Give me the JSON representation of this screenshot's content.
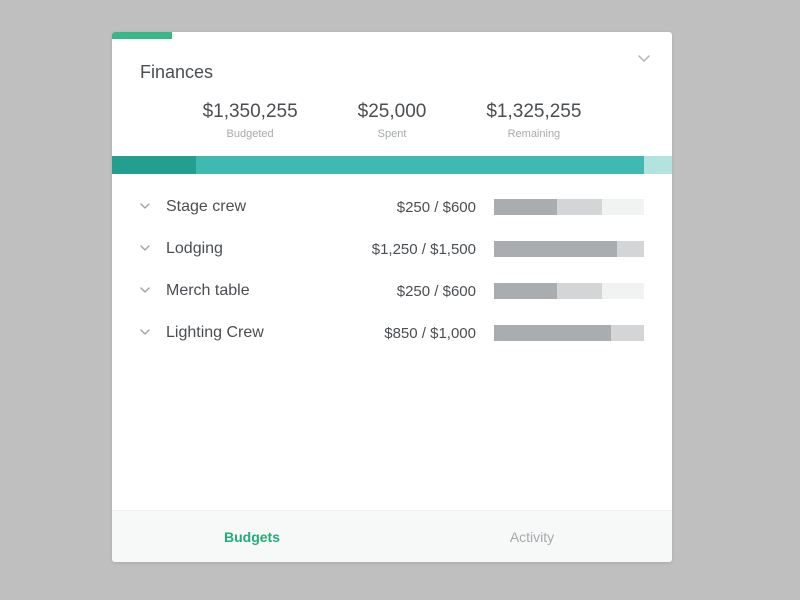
{
  "colors": {
    "accent": "#38b887",
    "strip1": "#239f8f",
    "strip2": "#3fbab0",
    "strip3": "#b2e3df"
  },
  "header": {
    "title": "Finances"
  },
  "summary": {
    "budgeted": {
      "value": "$1,350,255",
      "label": "Budgeted"
    },
    "spent": {
      "value": "$25,000",
      "label": "Spent"
    },
    "remaining": {
      "value": "$1,325,255",
      "label": "Remaining"
    }
  },
  "strip": {
    "seg1_pct": 15,
    "seg2_pct": 80,
    "seg3_pct": 5
  },
  "items": [
    {
      "name": "Stage crew",
      "amount": "$250 / $600",
      "bar": {
        "seg1_pct": 42,
        "seg2_pct": 30
      }
    },
    {
      "name": "Lodging",
      "amount": "$1,250 / $1,500",
      "bar": {
        "seg1_pct": 82,
        "seg2_pct": 18
      }
    },
    {
      "name": "Merch table",
      "amount": "$250 / $600",
      "bar": {
        "seg1_pct": 42,
        "seg2_pct": 30
      }
    },
    {
      "name": "Lighting Crew",
      "amount": "$850 / $1,000",
      "bar": {
        "seg1_pct": 78,
        "seg2_pct": 22
      }
    }
  ],
  "tabs": {
    "budgets": "Budgets",
    "activity": "Activity"
  }
}
